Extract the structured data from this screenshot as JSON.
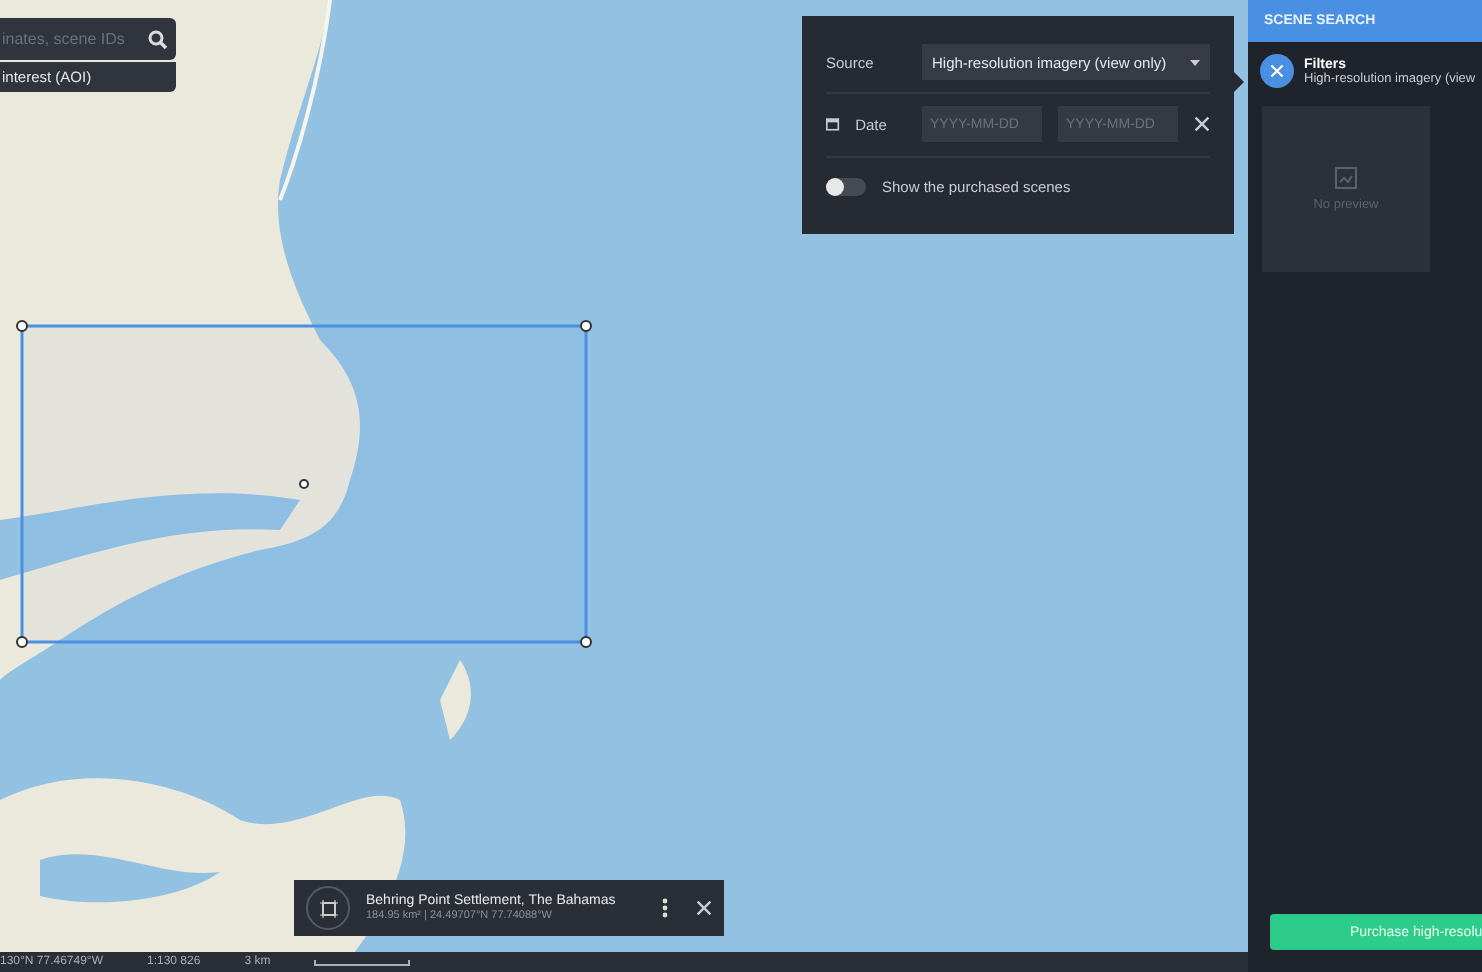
{
  "search": {
    "placeholder": "inates, scene IDs"
  },
  "aoi_button": {
    "label": "interest (AOI)"
  },
  "filters_popup": {
    "source_label": "Source",
    "source_value": "High-resolution imagery (view only)",
    "date_label": "Date",
    "date_from": {
      "placeholder": "YYYY-MM-DD"
    },
    "date_to": {
      "placeholder": "YYYY-MM-DD"
    },
    "toggle": {
      "label": "Show the purchased scenes",
      "on": false
    }
  },
  "aoi_card": {
    "title": "Behring Point Settlement, The Bahamas",
    "details": "184.95 km² | 24.49707°N 77.74088°W"
  },
  "status_bar": {
    "coordinates": "130°N 77.46749°W",
    "scale": "1:130 826",
    "scale_label": "3 km"
  },
  "panel": {
    "header": "SCENE SEARCH",
    "filters_title": "Filters",
    "filters_summary": "High-resolution imagery (view",
    "preview": "No preview",
    "purchase_button": "Purchase high-resolu"
  }
}
